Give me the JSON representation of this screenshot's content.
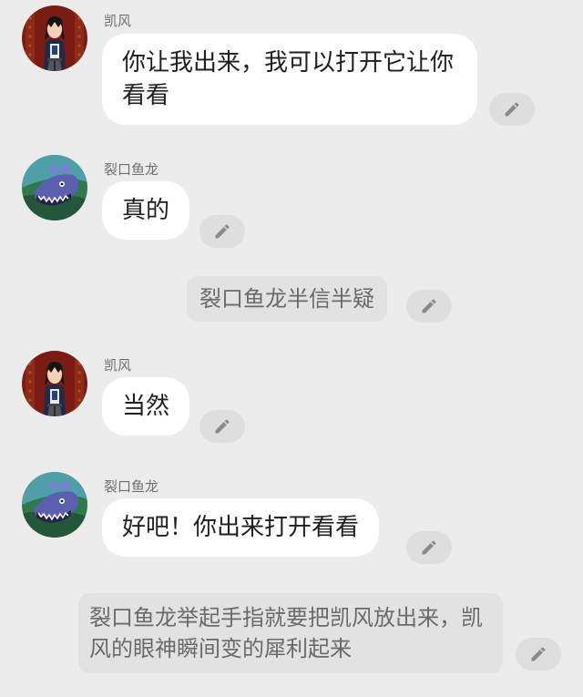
{
  "characters": {
    "kaifeng": {
      "name": "凯风",
      "avatar_icon": "kaifeng-avatar-icon"
    },
    "liekou": {
      "name": "裂口鱼龙",
      "avatar_icon": "liekou-avatar-icon"
    }
  },
  "messages": [
    {
      "type": "chat",
      "speaker": "凯风",
      "text": "你让我出来，我可以打开它让你看看"
    },
    {
      "type": "chat",
      "speaker": "裂口鱼龙",
      "text": "真的"
    },
    {
      "type": "narration",
      "text": "裂口鱼龙半信半疑"
    },
    {
      "type": "chat",
      "speaker": "凯风",
      "text": "当然"
    },
    {
      "type": "chat",
      "speaker": "裂口鱼龙",
      "text": "好吧！你出来打开看看"
    },
    {
      "type": "narration",
      "text": "裂口鱼龙举起手指就要把凯风放出来，凯风的眼神瞬间变的犀利起来"
    }
  ],
  "edit_icon": "pencil-icon",
  "colors": {
    "background": "#ececec",
    "bubble": "#ffffff",
    "narration_bubble": "#e2e2e2",
    "edit_button": "#dedede",
    "edit_icon": "#8a8a8a"
  }
}
